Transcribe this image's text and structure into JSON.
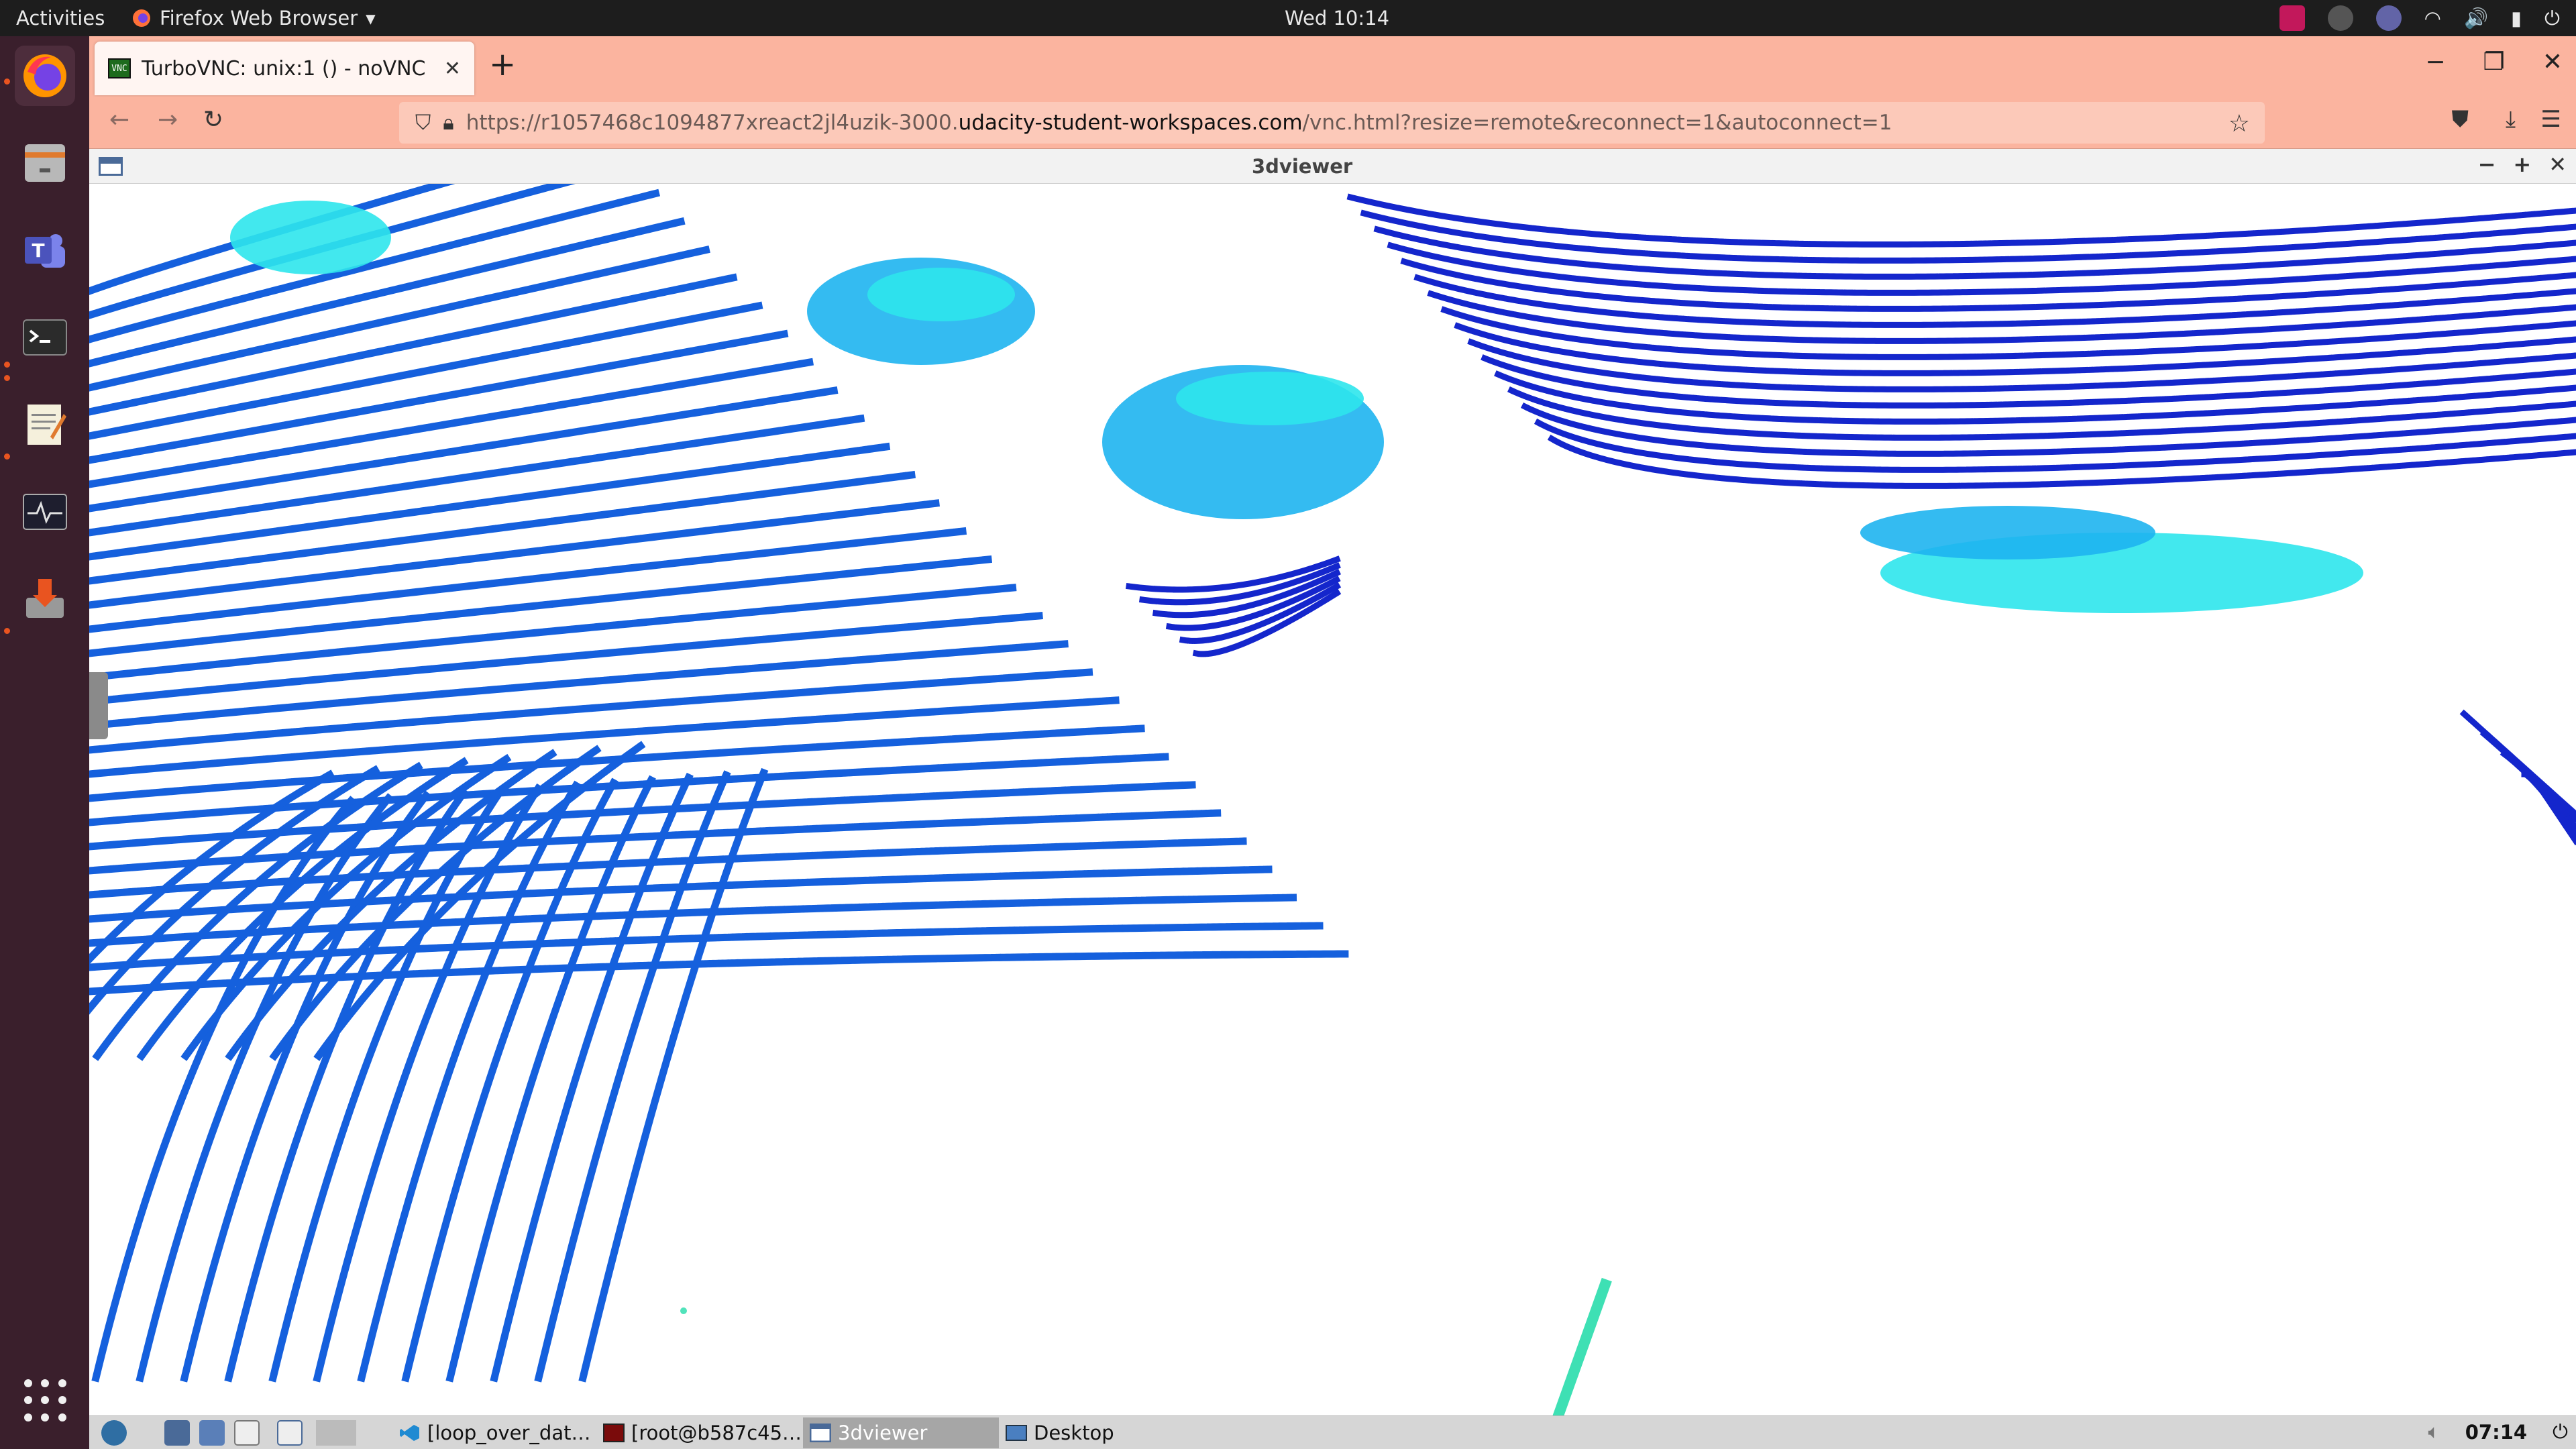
{
  "topbar": {
    "activities": "Activities",
    "app_name": "Firefox Web Browser",
    "clock": "Wed 10:14"
  },
  "browser": {
    "tab_title": "TurboVNC: unix:1 () - noVNC",
    "tab_favicon_text": "VNC",
    "url_prefix": "https://r1057468c1094877xreact2jl4uzik-3000.",
    "url_host": "udacity-student-workspaces.com",
    "url_path": "/vnc.html?resize=remote&reconnect=1&autoconnect=1"
  },
  "viewer": {
    "title": "3dviewer"
  },
  "taskbar": {
    "tasks": [
      {
        "label": "[loop_over_dat…"
      },
      {
        "label": "[root@b587c45…"
      },
      {
        "label": "3dviewer"
      },
      {
        "label": "Desktop"
      }
    ],
    "clock": "07:14"
  },
  "colors": {
    "ground_points": "#1560dd",
    "far_points": "#1426cc",
    "vehicle_points": "#1eb4f0",
    "vehicle_highlight": "#2ee6ec",
    "pole_points": "#3ee0b4",
    "firefox_tab_strip": "#fbb49f",
    "dock": "#3a1f2c"
  }
}
